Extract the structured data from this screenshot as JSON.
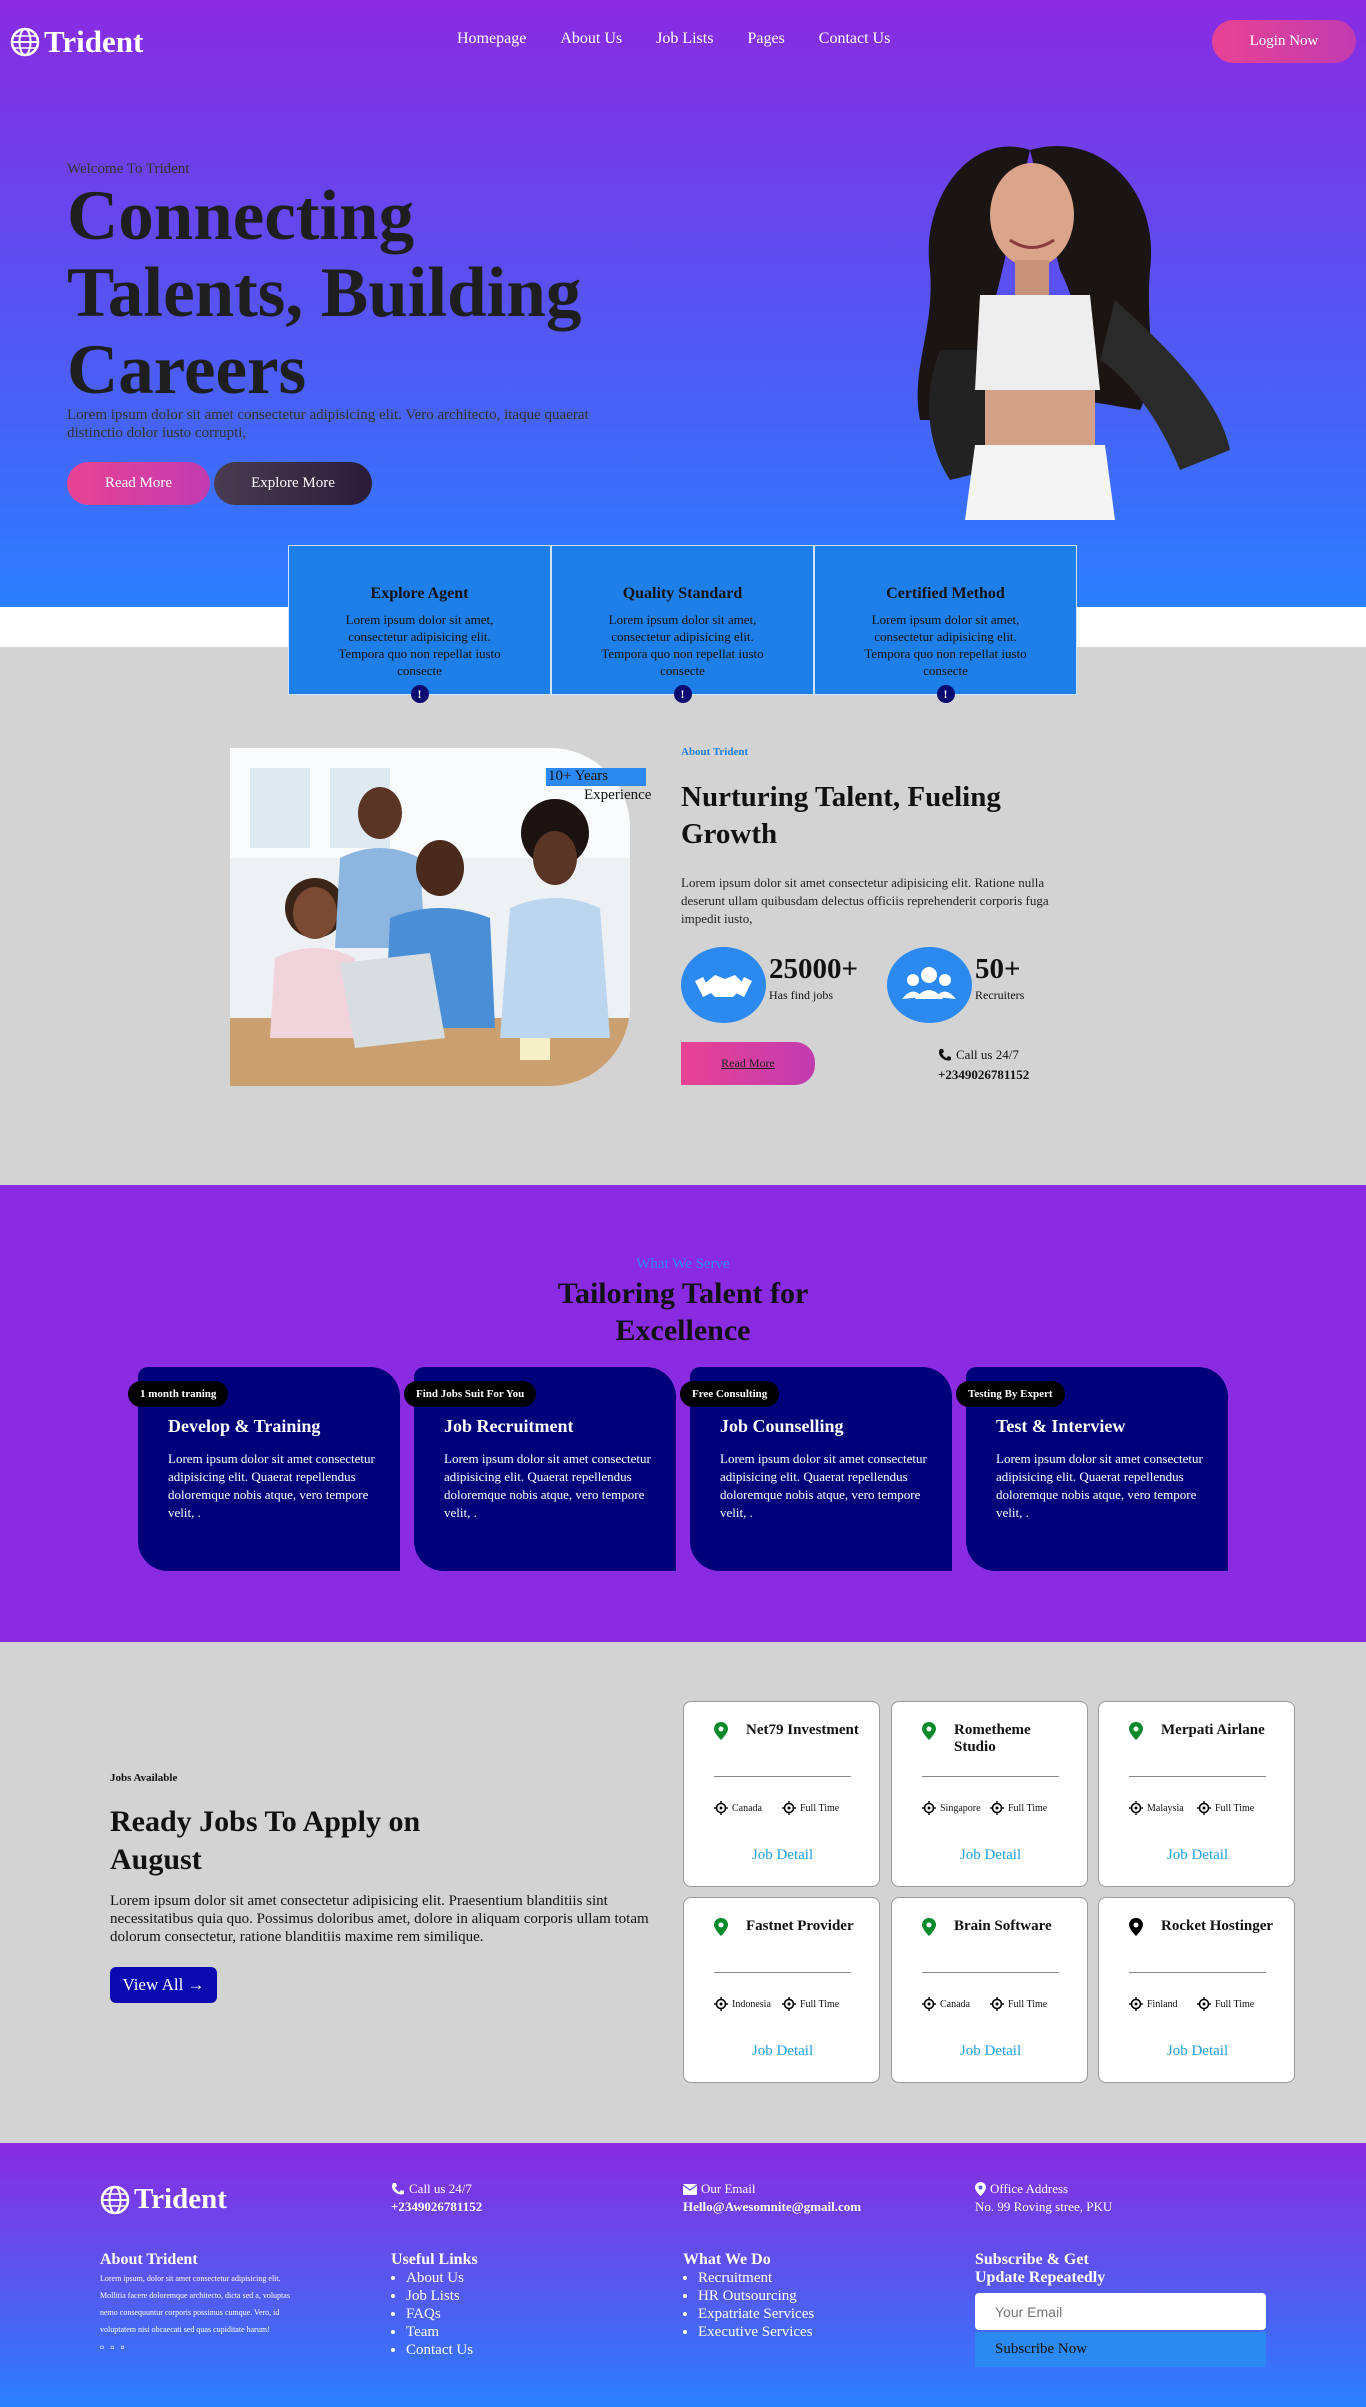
{
  "nav": {
    "logo": "Trident",
    "links": [
      "Homepage",
      "About Us",
      "Job Lists",
      "Pages",
      "Contact Us"
    ],
    "login": "Login Now"
  },
  "hero": {
    "welcome": "Welcome To Trident",
    "title": "Connecting Talents, Building Careers",
    "desc": "Lorem ipsum dolor sit amet consectetur adipisicing elit. Vero architecto, itaque quaerat distinctio dolor iusto corrupti,",
    "read_more": "Read More",
    "explore_more": "Explore More"
  },
  "features": [
    {
      "title": "Explore Agent",
      "desc": "Lorem ipsum dolor sit amet, consectetur adipisicing elit. Tempora quo non repellat iusto consecte",
      "marker": "!"
    },
    {
      "title": "Quality Standard",
      "desc": "Lorem ipsum dolor sit amet, consectetur adipisicing elit. Tempora quo non repellat iusto consecte",
      "marker": "!"
    },
    {
      "title": "Certified Method",
      "desc": "Lorem ipsum dolor sit amet, consectetur adipisicing elit. Tempora quo non repellat iusto consecte",
      "marker": "!"
    }
  ],
  "about": {
    "years": "10+ Years",
    "experience": "Experience",
    "tag": "About Trident",
    "title": "Nurturing Talent, Fueling Growth",
    "desc": "Lorem ipsum dolor sit amet consectetur adipisicing elit. Ratione nulla deserunt ullam quibusdam delectus officiis reprehenderit corporis fuga impedit iusto,",
    "stat1_num": "25000+",
    "stat1_label": "Has find jobs",
    "stat2_num": "50+",
    "stat2_label": "Recruiters",
    "read_more": "Read More",
    "call_label": "Call us 24/7",
    "call_number": "+2349026781152"
  },
  "services": {
    "tag": "What We Serve",
    "title": "Tailoring Talent for Excellence",
    "cards": [
      {
        "badge": "1 month traning",
        "title": "Develop & Training",
        "desc": "Lorem ipsum dolor sit amet consectetur adipisicing elit. Quaerat repellendus doloremque nobis atque, vero tempore velit, ."
      },
      {
        "badge": "Find Jobs Suit For You",
        "title": "Job Recruitment",
        "desc": "Lorem ipsum dolor sit amet consectetur adipisicing elit. Quaerat repellendus doloremque nobis atque, vero tempore velit, ."
      },
      {
        "badge": "Free Consulting",
        "title": "Job Counselling",
        "desc": "Lorem ipsum dolor sit amet consectetur adipisicing elit. Quaerat repellendus doloremque nobis atque, vero tempore velit, ."
      },
      {
        "badge": "Testing By Expert",
        "title": "Test & Interview",
        "desc": "Lorem ipsum dolor sit amet consectetur adipisicing elit. Quaerat repellendus doloremque nobis atque, vero tempore velit, ."
      }
    ]
  },
  "jobs": {
    "tag": "Jobs Available",
    "title": "Ready Jobs To Apply on August",
    "desc": "Lorem ipsum dolor sit amet consectetur adipisicing elit. Praesentium blanditiis sint necessitatibus quia quo. Possimus doloribus amet, dolore in aliquam corporis ullam totam dolorum consectetur, ratione blanditiis maxime rem similique.",
    "view_all": "View All →",
    "cards": [
      {
        "company": "Net79 Investment",
        "location": "Canada",
        "type": "Full Time",
        "link": "Job Detail"
      },
      {
        "company": "Rometheme Studio",
        "location": "Singapore",
        "type": "Full Time",
        "link": "Job Detail"
      },
      {
        "company": "Merpati Airlane",
        "location": "Malaysia",
        "type": "Full Time",
        "link": "Job Detail"
      },
      {
        "company": "Fastnet Provider",
        "location": "Indonesia",
        "type": "Full Time",
        "link": "Job Detail"
      },
      {
        "company": "Brain Software",
        "location": "Canada",
        "type": "Full Time",
        "link": "Job Detail"
      },
      {
        "company": "Rocket Hostinger",
        "location": "Finland",
        "type": "Full Time",
        "link": "Job Detail"
      }
    ]
  },
  "footer": {
    "logo": "Trident",
    "call_label": "Call us 24/7",
    "call_number": "+2349026781152",
    "email_label": "Our Email",
    "email": "Hello@Awesomnite@gmail.com",
    "office_label": "Office Address",
    "office": "No. 99 Roving stree, PKU",
    "about_head": "About Trident",
    "about_text": "Lorem ipsum, dolor sit amet consectetur adipisicing elit. Mollitia facere doloremque architecto, dicta sed a, voluptas nemo consequuntur corporis possimus cumque. Vero, id voluptatem nisi obcaecati sed quas cupiditate harum!",
    "social": [
      "▫",
      "▫",
      "▫"
    ],
    "links_head": "Useful Links",
    "links": [
      "About Us",
      "Job Lists",
      "FAQs",
      "Team",
      "Contact Us"
    ],
    "services_head": "What We Do",
    "services": [
      "Recruitment",
      "HR Outsourcing",
      "Expatriate Services",
      "Executive Services"
    ],
    "subscribe_head": "Subscribe & Get Update Repeatedly",
    "email_placeholder": "Your Email",
    "subscribe_btn": "Subscribe Now"
  },
  "colors": {
    "purple": "#8a2be2",
    "blue": "#2b89f0",
    "pink": "#e84393",
    "navy": "#00007a"
  }
}
